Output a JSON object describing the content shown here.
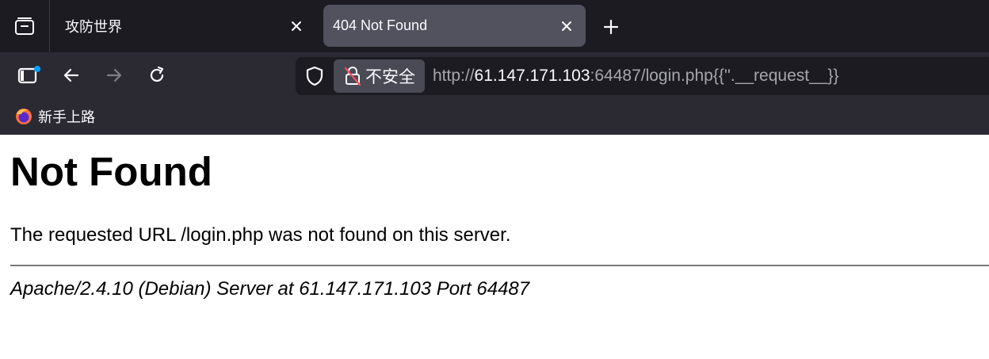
{
  "tabs": [
    {
      "title": "攻防世界",
      "active": false
    },
    {
      "title": "404 Not Found",
      "active": true
    }
  ],
  "toolbar": {
    "security_label": "不安全",
    "url_prefix": "http://",
    "url_host": "61.147.171.103",
    "url_rest": ":64487/login.php{{''.__request__}}"
  },
  "bookmarks": [
    {
      "label": "新手上路",
      "icon": "firefox-icon"
    }
  ],
  "page": {
    "heading": "Not Found",
    "message": "The requested URL /login.php was not found on this server.",
    "address": "Apache/2.4.10 (Debian) Server at 61.147.171.103 Port 64487"
  },
  "colors": {
    "chrome_dark": "#1c1b22",
    "toolbar": "#2b2a33",
    "active_tab": "#52525e",
    "notification_dot": "#00a2ff"
  }
}
